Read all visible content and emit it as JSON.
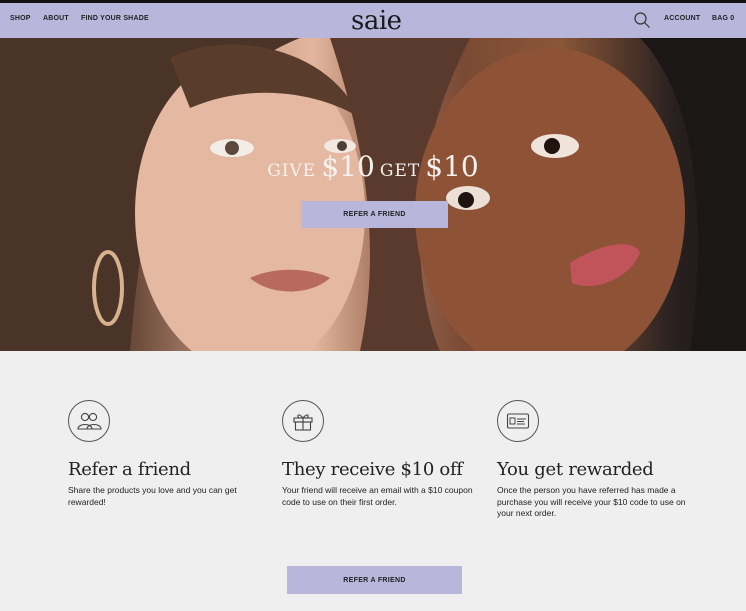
{
  "nav": {
    "links": [
      "SHOP",
      "ABOUT",
      "FIND YOUR SHADE"
    ],
    "logo": "saie",
    "account": "ACCOUNT",
    "bag": "BAG 0"
  },
  "hero": {
    "give": "GIVE",
    "give_amount": "$10",
    "get": "GET",
    "get_amount": "$10",
    "cta": "REFER A FRIEND"
  },
  "steps": [
    {
      "icon": "friends-icon",
      "title": "Refer a friend",
      "text": "Share the products you love and you can get rewarded!"
    },
    {
      "icon": "gift-icon",
      "title": "They receive $10 off",
      "text": "Your friend will receive an email with a $10 coupon code to use on their first order."
    },
    {
      "icon": "card-icon",
      "title": "You get rewarded",
      "text": "Once the person you have referred has made a purchase you will receive your $10 code to use on your next order."
    }
  ],
  "footer_cta": "REFER A FRIEND",
  "colors": {
    "accent": "#b9b6dc",
    "background": "#efeff0"
  }
}
